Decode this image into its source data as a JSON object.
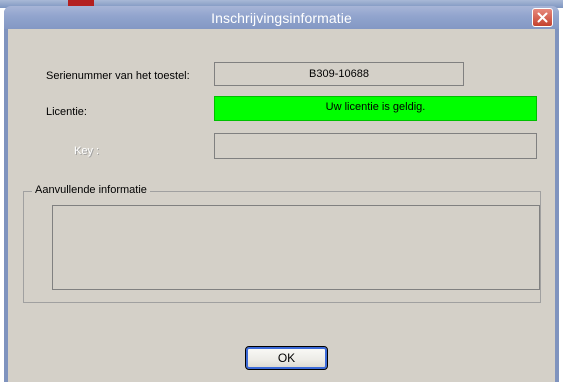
{
  "window": {
    "title": "Inschrijvingsinformatie"
  },
  "form": {
    "serial_label": "Serienummer van het toestel:",
    "serial_value": "B309-10688",
    "license_label": "Licentie:",
    "license_value": "Uw licentie is geldig.",
    "license_status_color": "#00ff00",
    "key_label": "Key :",
    "key_value": ""
  },
  "additional": {
    "group_title": "Aanvullende informatie",
    "content": ""
  },
  "buttons": {
    "ok_label": "OK"
  },
  "icons": {
    "close": "close-icon"
  }
}
